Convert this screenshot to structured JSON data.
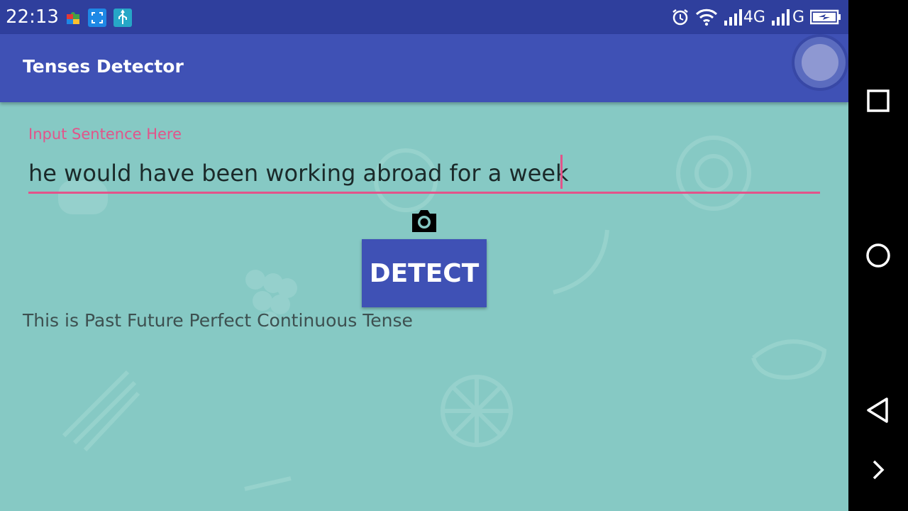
{
  "status_bar": {
    "time": "22:13",
    "left_icons": [
      "puzzle-icon",
      "screenshot-icon",
      "usb-icon"
    ],
    "right_icons": [
      "alarm-icon",
      "wifi-icon",
      "signal-icon",
      "signal-icon",
      "battery-charging-icon"
    ],
    "network_1": "4G",
    "network_2": "G"
  },
  "app_bar": {
    "title": "Tenses Detector"
  },
  "form": {
    "label": "Input Sentence Here",
    "value": "he would have been working abroad for a week",
    "camera_icon": "camera-icon",
    "detect_label": "DETECT",
    "result": "This is Past Future Perfect Continuous Tense"
  },
  "nav_bar": {
    "icons": [
      "recents-icon",
      "home-icon",
      "back-icon",
      "chevron-right-icon"
    ]
  },
  "colors": {
    "status_bar": "#2f3f9d",
    "app_bar": "#3f51b5",
    "background": "#86c9c4",
    "accent": "#e2548a",
    "button": "#3f51b5"
  }
}
